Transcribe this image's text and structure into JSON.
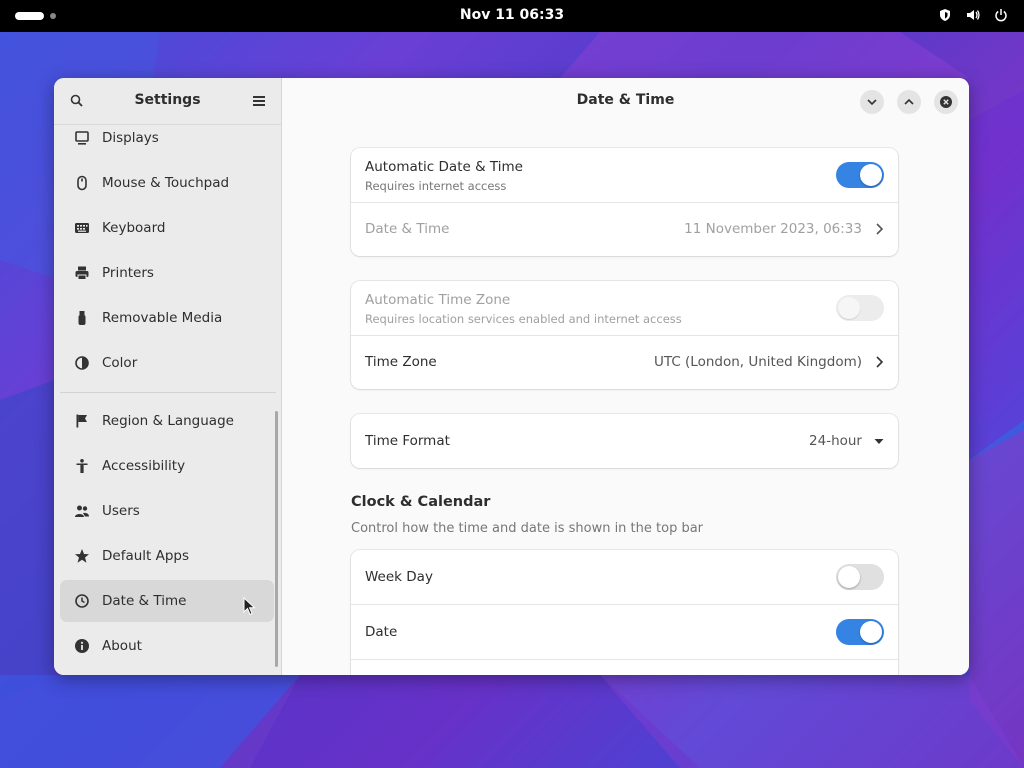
{
  "topbar": {
    "clock": "Nov 11  06:33",
    "icons": [
      "shield-icon",
      "volume-icon",
      "power-icon"
    ]
  },
  "sidebar": {
    "title": "Settings",
    "items": [
      {
        "label": "Displays",
        "icon": "display-icon"
      },
      {
        "label": "Mouse & Touchpad",
        "icon": "mouse-icon"
      },
      {
        "label": "Keyboard",
        "icon": "keyboard-icon"
      },
      {
        "label": "Printers",
        "icon": "printer-icon"
      },
      {
        "label": "Removable Media",
        "icon": "usb-icon"
      },
      {
        "label": "Color",
        "icon": "color-icon"
      },
      {
        "label": "Region & Language",
        "icon": "flag-icon"
      },
      {
        "label": "Accessibility",
        "icon": "accessibility-icon"
      },
      {
        "label": "Users",
        "icon": "users-icon"
      },
      {
        "label": "Default Apps",
        "icon": "star-icon"
      },
      {
        "label": "Date & Time",
        "icon": "clock-icon",
        "active": true
      },
      {
        "label": "About",
        "icon": "info-icon"
      }
    ]
  },
  "main": {
    "title": "Date & Time",
    "auto_datetime": {
      "title": "Automatic Date & Time",
      "subtitle": "Requires internet access",
      "enabled": true
    },
    "datetime": {
      "title": "Date & Time",
      "value": "11 November 2023, 06:33"
    },
    "auto_timezone": {
      "title": "Automatic Time Zone",
      "subtitle": "Requires location services enabled and internet access",
      "enabled": false
    },
    "timezone": {
      "title": "Time Zone",
      "value": "UTC (London, United Kingdom)"
    },
    "time_format": {
      "title": "Time Format",
      "value": "24-hour"
    },
    "clock_calendar": {
      "title": "Clock & Calendar",
      "subtitle": "Control how the time and date is shown in the top bar",
      "week_day": {
        "title": "Week Day",
        "enabled": false
      },
      "date": {
        "title": "Date",
        "enabled": true
      }
    }
  },
  "colors": {
    "accent": "#3584e4",
    "topbar": "#000000",
    "sidebar": "#ebebeb"
  }
}
